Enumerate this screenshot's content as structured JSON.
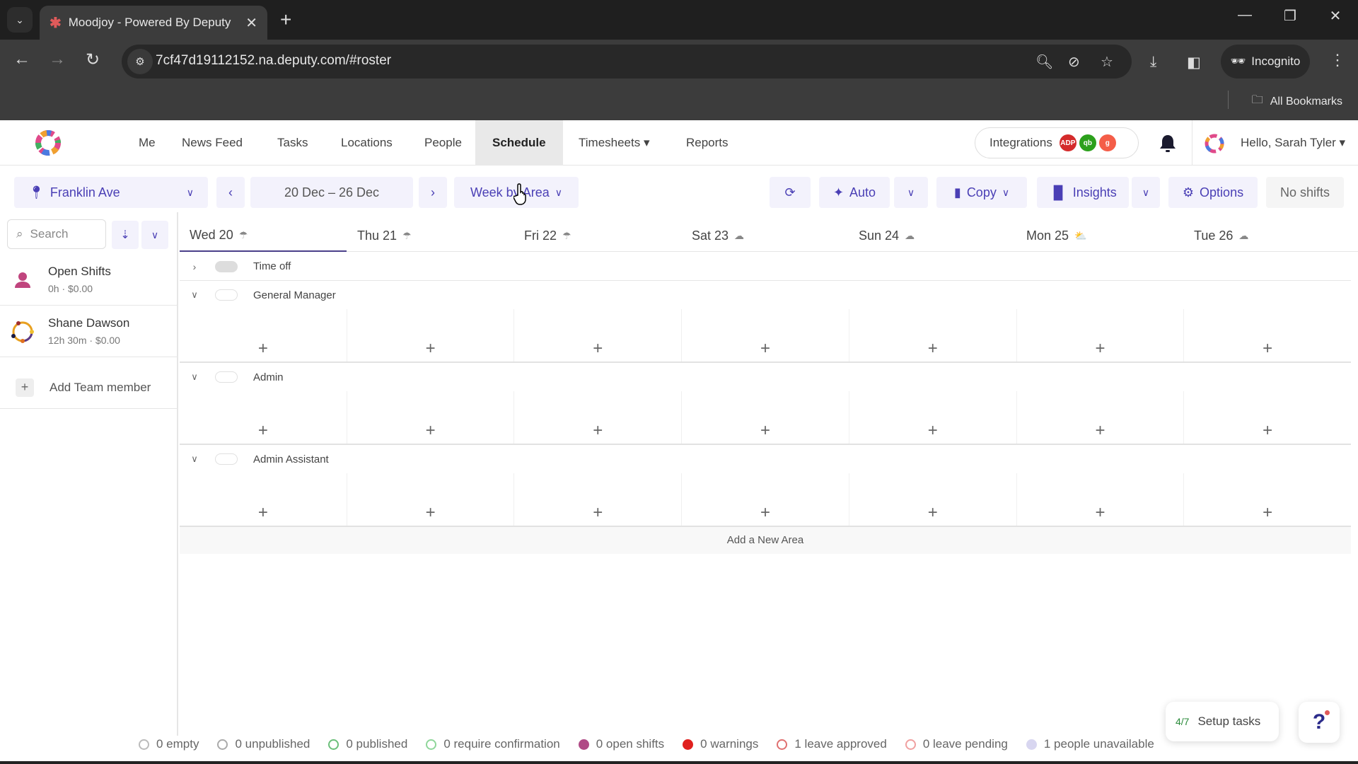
{
  "browser": {
    "tab_title": "Moodjoy - Powered By Deputy",
    "url": "7cf47d19112152.na.deputy.com/#roster",
    "incognito_label": "Incognito",
    "bookmarks_label": "All Bookmarks"
  },
  "nav": {
    "items": [
      {
        "label": "Me"
      },
      {
        "label": "News Feed"
      },
      {
        "label": "Tasks"
      },
      {
        "label": "Locations"
      },
      {
        "label": "People"
      },
      {
        "label": "Schedule",
        "active": true
      },
      {
        "label": "Timesheets ▾"
      },
      {
        "label": "Reports"
      }
    ],
    "integrations_label": "Integrations",
    "integration_badges": [
      {
        "name": "adp",
        "text": "ADP",
        "color": "#d42b2b"
      },
      {
        "name": "quickbooks",
        "text": "qb",
        "color": "#2ca01c"
      },
      {
        "name": "gusto",
        "text": "g",
        "color": "#f45d48"
      }
    ],
    "greeting": "Hello, Sarah Tyler ▾"
  },
  "toolbar": {
    "location": "Franklin Ave",
    "date_range": "20 Dec – 26 Dec",
    "view": "Week by Area",
    "auto_label": "Auto",
    "copy_label": "Copy",
    "insights_label": "Insights",
    "options_label": "Options",
    "no_shifts_label": "No shifts"
  },
  "sidebar": {
    "search_placeholder": "Search",
    "people": [
      {
        "name": "Open Shifts",
        "meta": "0h · $0.00"
      },
      {
        "name": "Shane Dawson",
        "meta": "12h 30m · $0.00"
      }
    ],
    "add_member_label": "Add Team member"
  },
  "days": [
    {
      "label": "Wed 20",
      "weather": "rain"
    },
    {
      "label": "Thu 21",
      "weather": "rain"
    },
    {
      "label": "Fri 22",
      "weather": "rain"
    },
    {
      "label": "Sat 23",
      "weather": "cloud"
    },
    {
      "label": "Sun 24",
      "weather": "cloud"
    },
    {
      "label": "Mon 25",
      "weather": "partly-sunny"
    },
    {
      "label": "Tue 26",
      "weather": "cloud"
    }
  ],
  "time_off_label": "Time off",
  "areas": [
    {
      "name": "General Manager"
    },
    {
      "name": "Admin"
    },
    {
      "name": "Admin Assistant"
    }
  ],
  "add_area_label": "Add a New Area",
  "legend": [
    {
      "label": "0 empty",
      "color": "#bbbbbb",
      "filled": false
    },
    {
      "label": "0 unpublished",
      "color": "#aaaaaa",
      "filled": false
    },
    {
      "label": "0 published",
      "color": "#6bbf7a",
      "filled": false
    },
    {
      "label": "0 require confirmation",
      "color": "#8fd69a",
      "filled": false
    },
    {
      "label": "0 open shifts",
      "color": "#b04a86",
      "filled": true
    },
    {
      "label": "0 warnings",
      "color": "#e0201e",
      "filled": true
    },
    {
      "label": "1 leave approved",
      "color": "#e07070",
      "filled": false
    },
    {
      "label": "0 leave pending",
      "color": "#f0a0a0",
      "filled": false
    },
    {
      "label": "1 people unavailable",
      "color": "#d8d6f0",
      "filled": true
    }
  ],
  "setup": {
    "progress": "4/7",
    "label": "Setup tasks"
  },
  "help_label": "?"
}
